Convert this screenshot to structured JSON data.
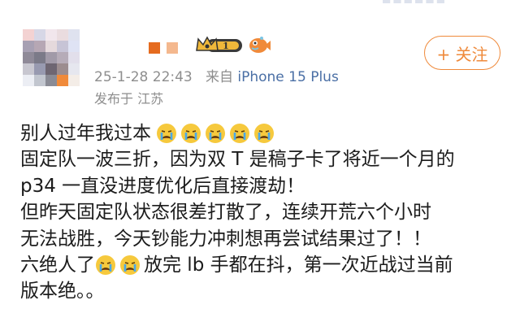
{
  "user": {
    "vip_level": "1"
  },
  "post": {
    "timestamp": "25-1-28 22:43",
    "source_prefix": "来自",
    "device": "iPhone 15 Plus",
    "location": "发布于 江苏"
  },
  "follow_button": {
    "label": "+ 关注"
  },
  "content": {
    "line1": "别人过年我过本",
    "line2": "固定队一波三折，因为双 T 是稿子卡了将近一个月的",
    "line3": "p34 一直没进度优化后直接渡劫！",
    "line4": "但昨天固定队状态很差打散了，连续开荒六个小时",
    "line5": "无法战胜，今天钞能力冲刺想再尝试结果过了！！",
    "line6a": "六绝人了",
    "line6b": "放完 lb 手都在抖，第一次近战过当前",
    "line7": "版本绝。。"
  },
  "icons": {
    "emoji": "crying-face-icon",
    "badge": "vip-crown-badge",
    "fish": "fish-icon"
  },
  "colors": {
    "accent": "#ef8a3b",
    "meta": "#8e8e8e",
    "device_link": "#4a6fa5"
  }
}
